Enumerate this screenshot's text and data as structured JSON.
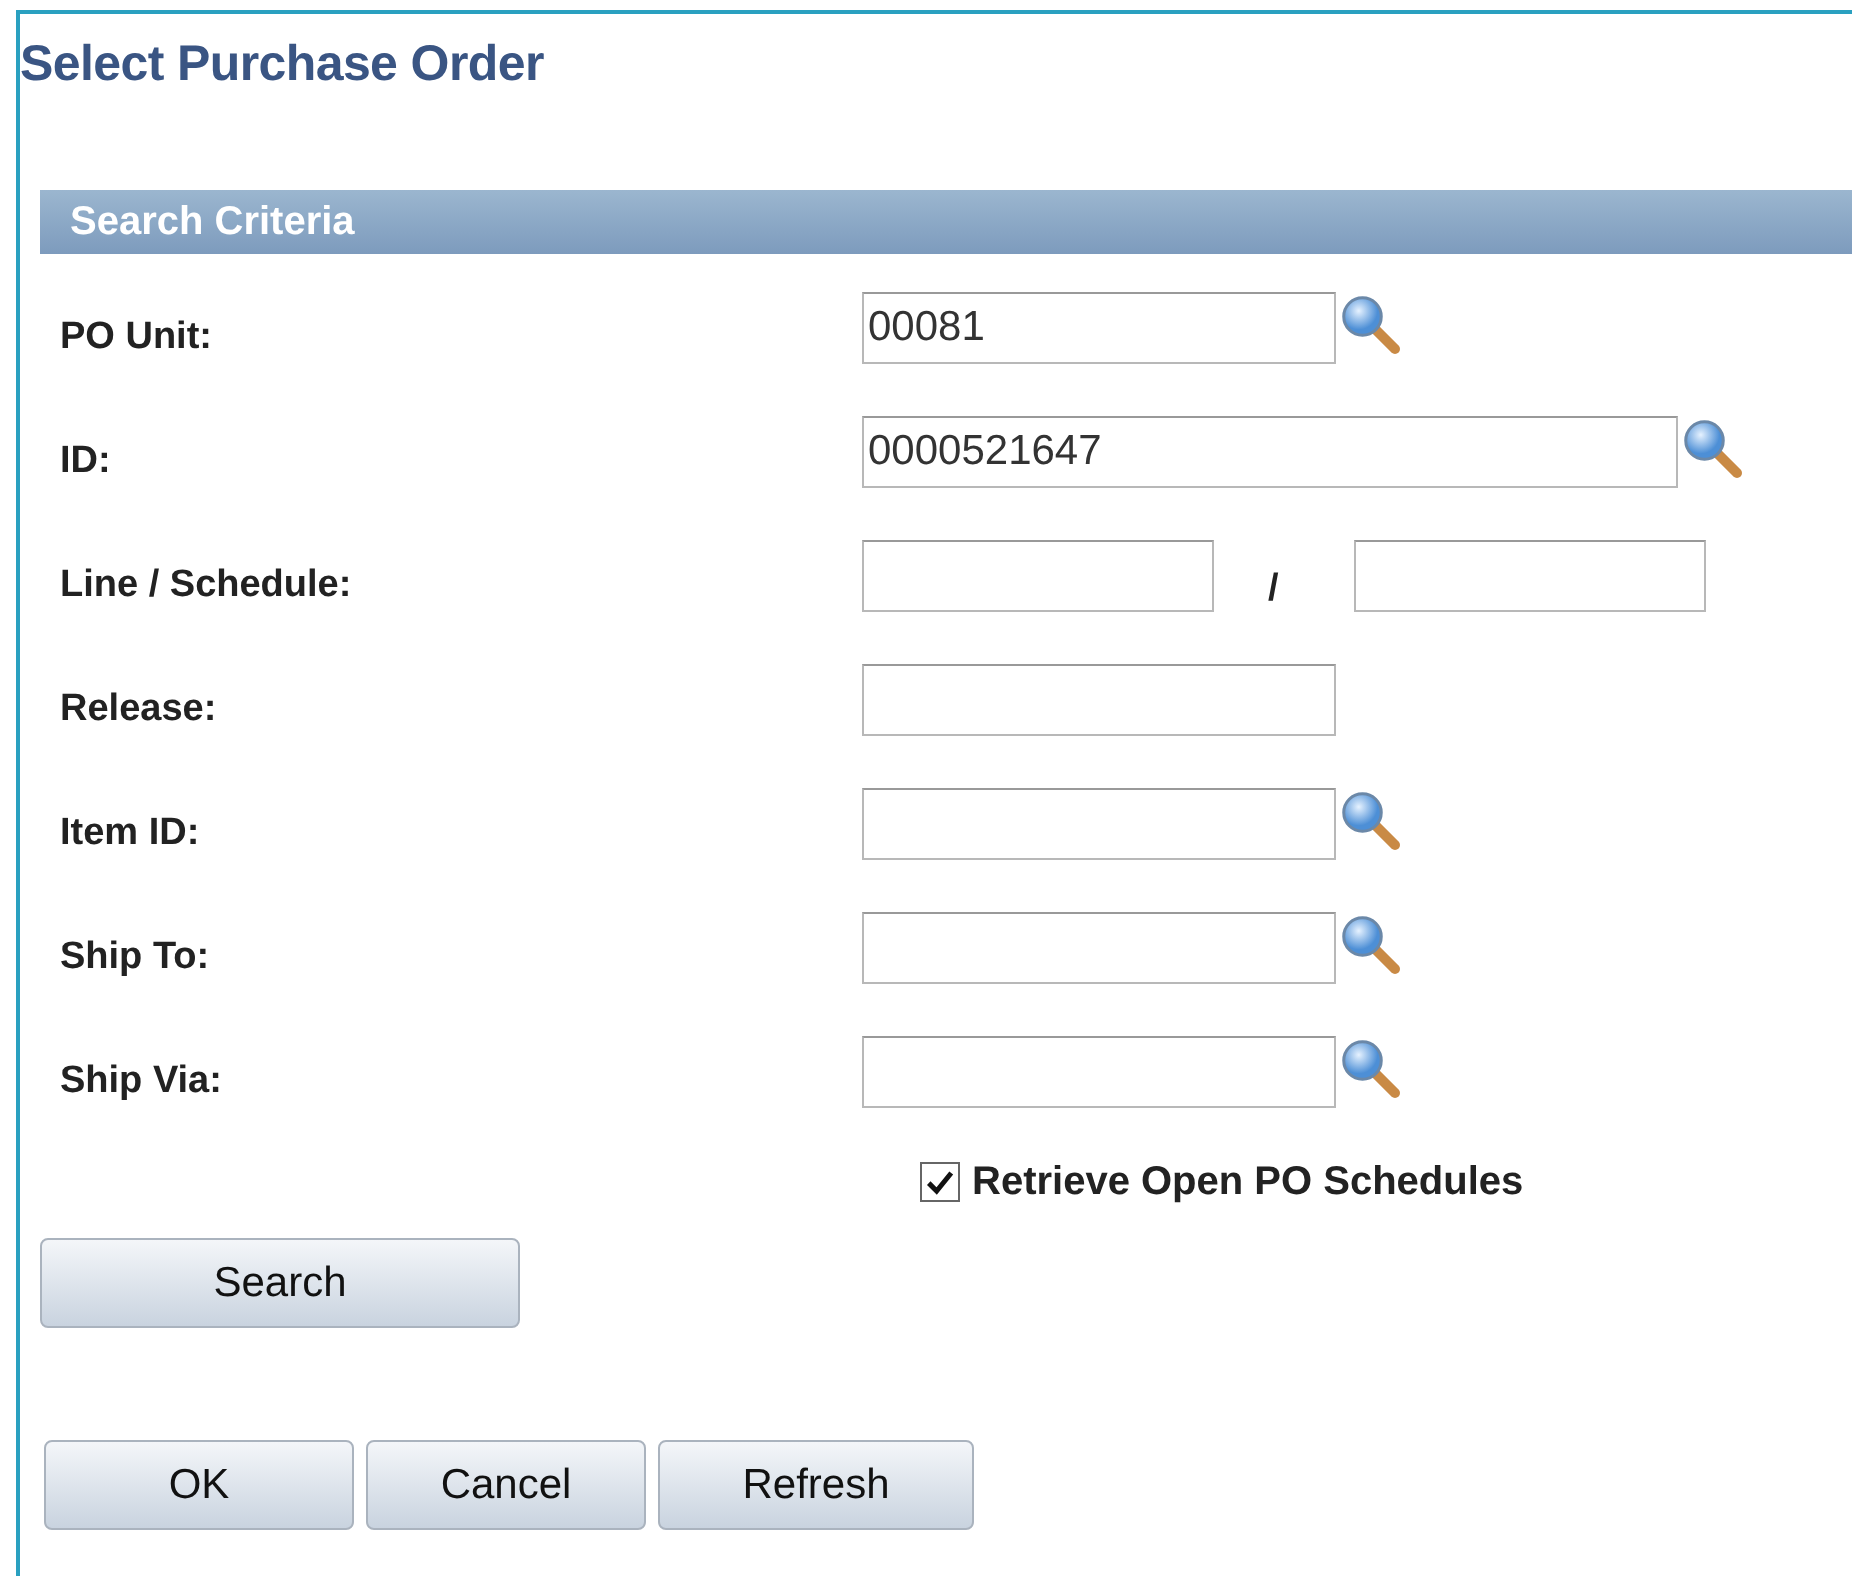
{
  "window": {
    "title": "Select Purchase Order"
  },
  "section": {
    "title": "Search Criteria"
  },
  "fields": [
    {
      "kind": "lookup",
      "label": "PO Unit:",
      "value": "00081"
    },
    {
      "kind": "long_lookup",
      "label": "ID:",
      "value": "0000521647"
    },
    {
      "kind": "pair",
      "label": "Line / Schedule:",
      "separator": "/"
    },
    {
      "kind": "plain",
      "label": "Release:"
    },
    {
      "kind": "lookup",
      "label": "Item ID:"
    },
    {
      "kind": "lookup",
      "label": "Ship To:"
    },
    {
      "kind": "lookup",
      "label": "Ship Via:"
    }
  ],
  "checkbox": {
    "label": "Retrieve Open PO Schedules",
    "checked": true
  },
  "search_button": "Search",
  "buttons": [
    "OK",
    "Cancel",
    "Refresh"
  ]
}
